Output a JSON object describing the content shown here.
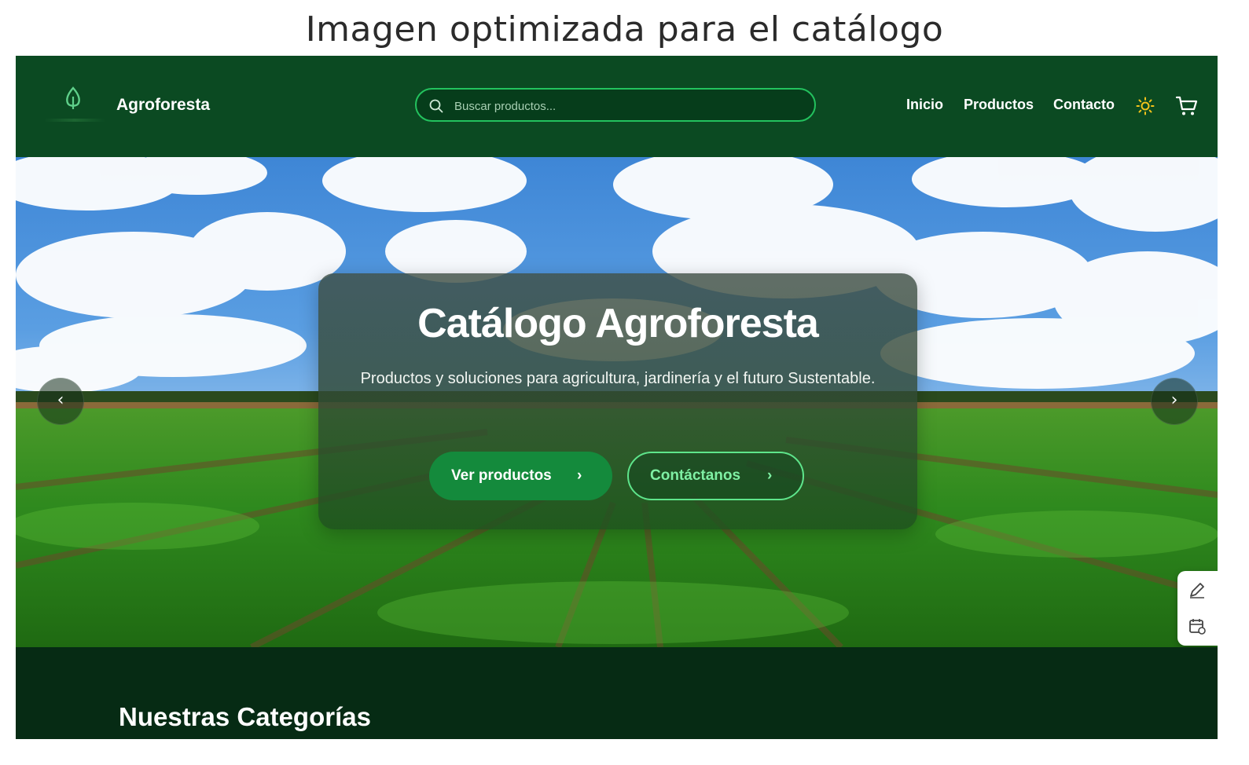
{
  "figure_title": "Imagen optimizada para el catálogo",
  "header": {
    "brand": "Agroforesta",
    "search_placeholder": "Buscar productos...",
    "nav": {
      "inicio": "Inicio",
      "productos": "Productos",
      "contacto": "Contacto"
    },
    "icons": [
      "leaf-logo-icon",
      "search-icon",
      "sun-icon",
      "cart-icon"
    ]
  },
  "hero": {
    "title": "Catálogo Agroforesta",
    "subtitle": "Productos y soluciones para agricultura, jardinería y el futuro Sustentable.",
    "primary_button": "Ver productos",
    "secondary_button": "Contáctanos",
    "chevron": "›",
    "prev_arrow": "‹",
    "next_arrow": "›"
  },
  "tools": [
    "edit-icon",
    "calendar-icon",
    "plane-icon"
  ],
  "categories": {
    "heading": "Nuestras Categorías"
  },
  "colors": {
    "header_bg": "#0b4a22",
    "accent": "#23c25e",
    "button_primary": "#148a3c",
    "section_bg": "#062b14",
    "sun": "#f2c21b"
  }
}
